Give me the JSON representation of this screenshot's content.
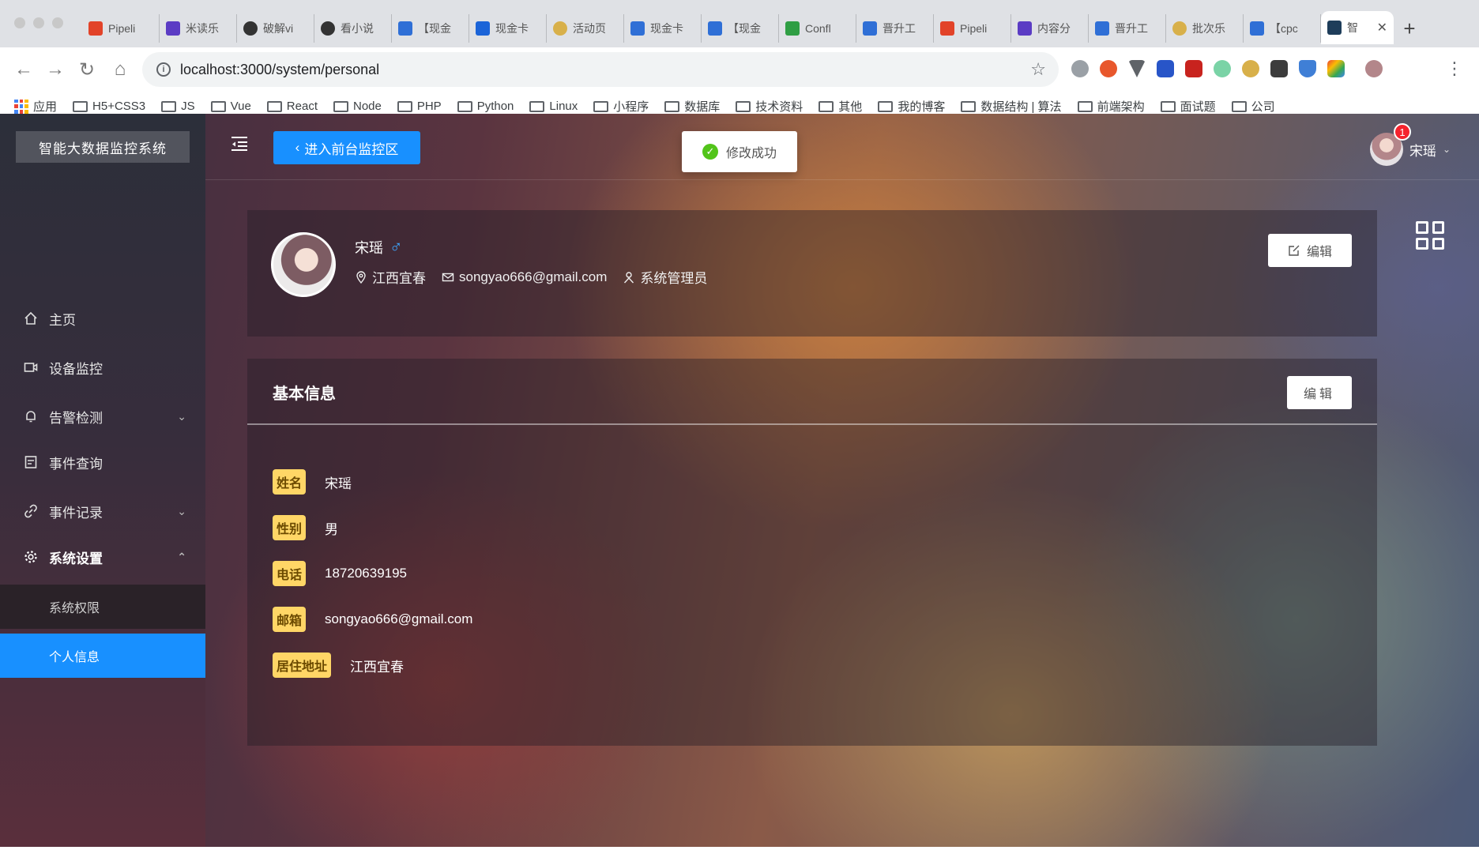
{
  "browser": {
    "tabs": [
      {
        "title": "Pipeli",
        "color": "#e24329"
      },
      {
        "title": "米读乐",
        "color": "#5b3cc4"
      },
      {
        "title": "破解vi",
        "color": "#333333"
      },
      {
        "title": "看小说",
        "color": "#333333"
      },
      {
        "title": "【现金",
        "color": "#2f6fd6"
      },
      {
        "title": "现金卡",
        "color": "#1b64d8"
      },
      {
        "title": "活动页",
        "color": "#d8b04a"
      },
      {
        "title": "现金卡",
        "color": "#2f6fd6"
      },
      {
        "title": "【现金",
        "color": "#2f6fd6"
      },
      {
        "title": "Confl",
        "color": "#2f9e44"
      },
      {
        "title": "晋升工",
        "color": "#2f6fd6"
      },
      {
        "title": "Pipeli",
        "color": "#e24329"
      },
      {
        "title": "内容分",
        "color": "#5b3cc4"
      },
      {
        "title": "晋升工",
        "color": "#2f6fd6"
      },
      {
        "title": "批次乐",
        "color": "#d8b04a"
      },
      {
        "title": "【cpc",
        "color": "#2f6fd6"
      },
      {
        "title": "智",
        "color": "#1e3d5a",
        "active": true
      }
    ],
    "url": "localhost:3000/system/personal",
    "bookmarks": [
      "应用",
      "H5+CSS3",
      "JS",
      "Vue",
      "React",
      "Node",
      "PHP",
      "Python",
      "Linux",
      "小程序",
      "数据库",
      "技术资料",
      "其他",
      "我的博客",
      "数据结构 | 算法",
      "前端架构",
      "面试题",
      "公司"
    ]
  },
  "sidebar": {
    "logo": "智能大数据监控系统",
    "items": [
      {
        "label": "主页",
        "icon": "home-icon"
      },
      {
        "label": "设备监控",
        "icon": "video-icon"
      },
      {
        "label": "告警检测",
        "icon": "bell-icon"
      },
      {
        "label": "事件查询",
        "icon": "calendar-icon"
      },
      {
        "label": "事件记录",
        "icon": "link-icon"
      },
      {
        "label": "系统设置",
        "icon": "gear-icon"
      }
    ],
    "subitems": [
      {
        "label": "系统权限"
      },
      {
        "label": "个人信息"
      }
    ]
  },
  "header": {
    "front_button": "进入前台监控区",
    "toast": "修改成功",
    "user_name": "宋瑶",
    "notification_count": "1"
  },
  "profile": {
    "name": "宋瑶",
    "gender_symbol": "♂",
    "location": "江西宜春",
    "email": "songyao666@gmail.com",
    "role": "系统管理员",
    "edit_label": "编辑"
  },
  "basic_info": {
    "title": "基本信息",
    "edit_label": "编辑",
    "fields": [
      {
        "label": "姓名",
        "value": "宋瑶"
      },
      {
        "label": "性别",
        "value": "男"
      },
      {
        "label": "电话",
        "value": "18720639195"
      },
      {
        "label": "邮箱",
        "value": "songyao666@gmail.com"
      },
      {
        "label": "居住地址",
        "value": "江西宜春"
      }
    ]
  },
  "colors": {
    "primary": "#1890ff",
    "success": "#52c41a",
    "tag_bg": "#ffd666",
    "badge": "#f5222d"
  }
}
